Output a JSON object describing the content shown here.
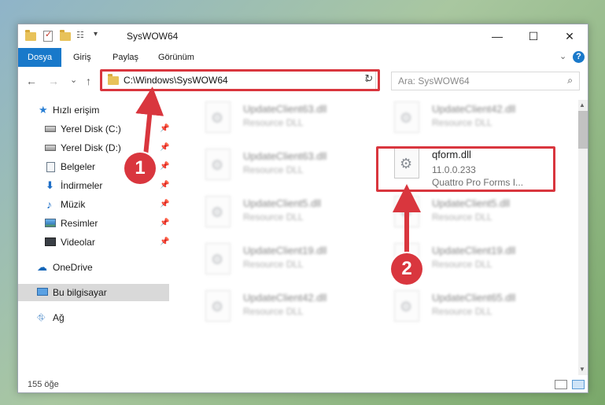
{
  "window": {
    "title": "SysWOW64"
  },
  "caption": {
    "minimize": "—",
    "maximize": "☐",
    "close": "✕"
  },
  "ribbon": {
    "tabs": [
      {
        "label": "Dosya"
      },
      {
        "label": "Giriş"
      },
      {
        "label": "Paylaş"
      },
      {
        "label": "Görünüm"
      }
    ],
    "collapse": "⌄",
    "help": "?"
  },
  "nav": {
    "back": "←",
    "forward": "→",
    "recent": "⌄",
    "up": "↑",
    "address": "C:\\Windows\\SysWOW64",
    "address_dropdown": "⌄",
    "refresh": "↻",
    "search_placeholder": "Ara: SysWOW64",
    "search_icon": "⌕"
  },
  "sidebar": {
    "quick_access": "Hızlı erişim",
    "items": [
      {
        "label": "Yerel Disk (C:)",
        "icon": "drive-icon"
      },
      {
        "label": "Yerel Disk (D:)",
        "icon": "drive-icon"
      },
      {
        "label": "Belgeler",
        "icon": "documents-icon"
      },
      {
        "label": "İndirmeler",
        "icon": "downloads-icon"
      },
      {
        "label": "Müzik",
        "icon": "music-icon"
      },
      {
        "label": "Resimler",
        "icon": "pictures-icon"
      },
      {
        "label": "Videolar",
        "icon": "videos-icon"
      }
    ],
    "onedrive": "OneDrive",
    "this_pc": "Bu bilgisayar",
    "network": "Ağ",
    "pin": "📌"
  },
  "files": {
    "left_column": [
      {
        "name": "UpdateClient63.dll",
        "type": "Resource DLL"
      },
      {
        "name": "UpdateClient63.dll",
        "type": "Resource DLL"
      },
      {
        "name": "UpdateClient5.dll",
        "type": "Resource DLL"
      },
      {
        "name": "UpdateClient19.dll",
        "type": "Resource DLL"
      },
      {
        "name": "UpdateClient42.dll",
        "type": "Resource DLL"
      }
    ],
    "right_column": [
      {
        "name": "UpdateClient42.dll",
        "type": "Resource DLL"
      },
      {
        "name": "UpdateClient5.dll",
        "type": "Resource DLL"
      },
      {
        "name": "UpdateClient19.dll",
        "type": "Resource DLL"
      },
      {
        "name": "UpdateClient65.dll",
        "type": "Resource DLL"
      }
    ],
    "highlighted": {
      "name": "qform.dll",
      "version": "11.0.0.233",
      "description": "Quattro Pro Forms I..."
    }
  },
  "status": {
    "count": "155 öğe"
  },
  "callouts": {
    "one": "1",
    "two": "2"
  },
  "colors": {
    "accent": "#1979ca",
    "highlight": "#d9363e"
  }
}
